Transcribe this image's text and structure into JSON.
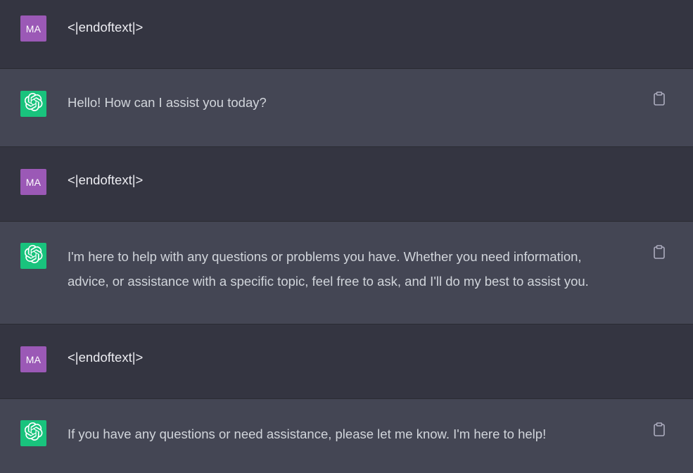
{
  "colors": {
    "user_bg": "#343541",
    "assistant_bg": "#444654",
    "user_avatar": "#9b59b6",
    "assistant_avatar": "#19c37d",
    "text": "#d1d5db"
  },
  "messages": [
    {
      "role": "user",
      "avatar_text": "MA",
      "text": "<|endoftext|>"
    },
    {
      "role": "assistant",
      "avatar_icon": "openai-logo-icon",
      "text": "Hello! How can I assist you today?",
      "action_icon": "clipboard-icon"
    },
    {
      "role": "user",
      "avatar_text": "MA",
      "text": "<|endoftext|>"
    },
    {
      "role": "assistant",
      "avatar_icon": "openai-logo-icon",
      "text": "I'm here to help with any questions or problems you have. Whether you need information, advice, or assistance with a specific topic, feel free to ask, and I'll do my best to assist you.",
      "action_icon": "clipboard-icon"
    },
    {
      "role": "user",
      "avatar_text": "MA",
      "text": "<|endoftext|>"
    },
    {
      "role": "assistant",
      "avatar_icon": "openai-logo-icon",
      "text": "If you have any questions or need assistance, please let me know. I'm here to help!",
      "action_icon": "clipboard-icon"
    }
  ]
}
